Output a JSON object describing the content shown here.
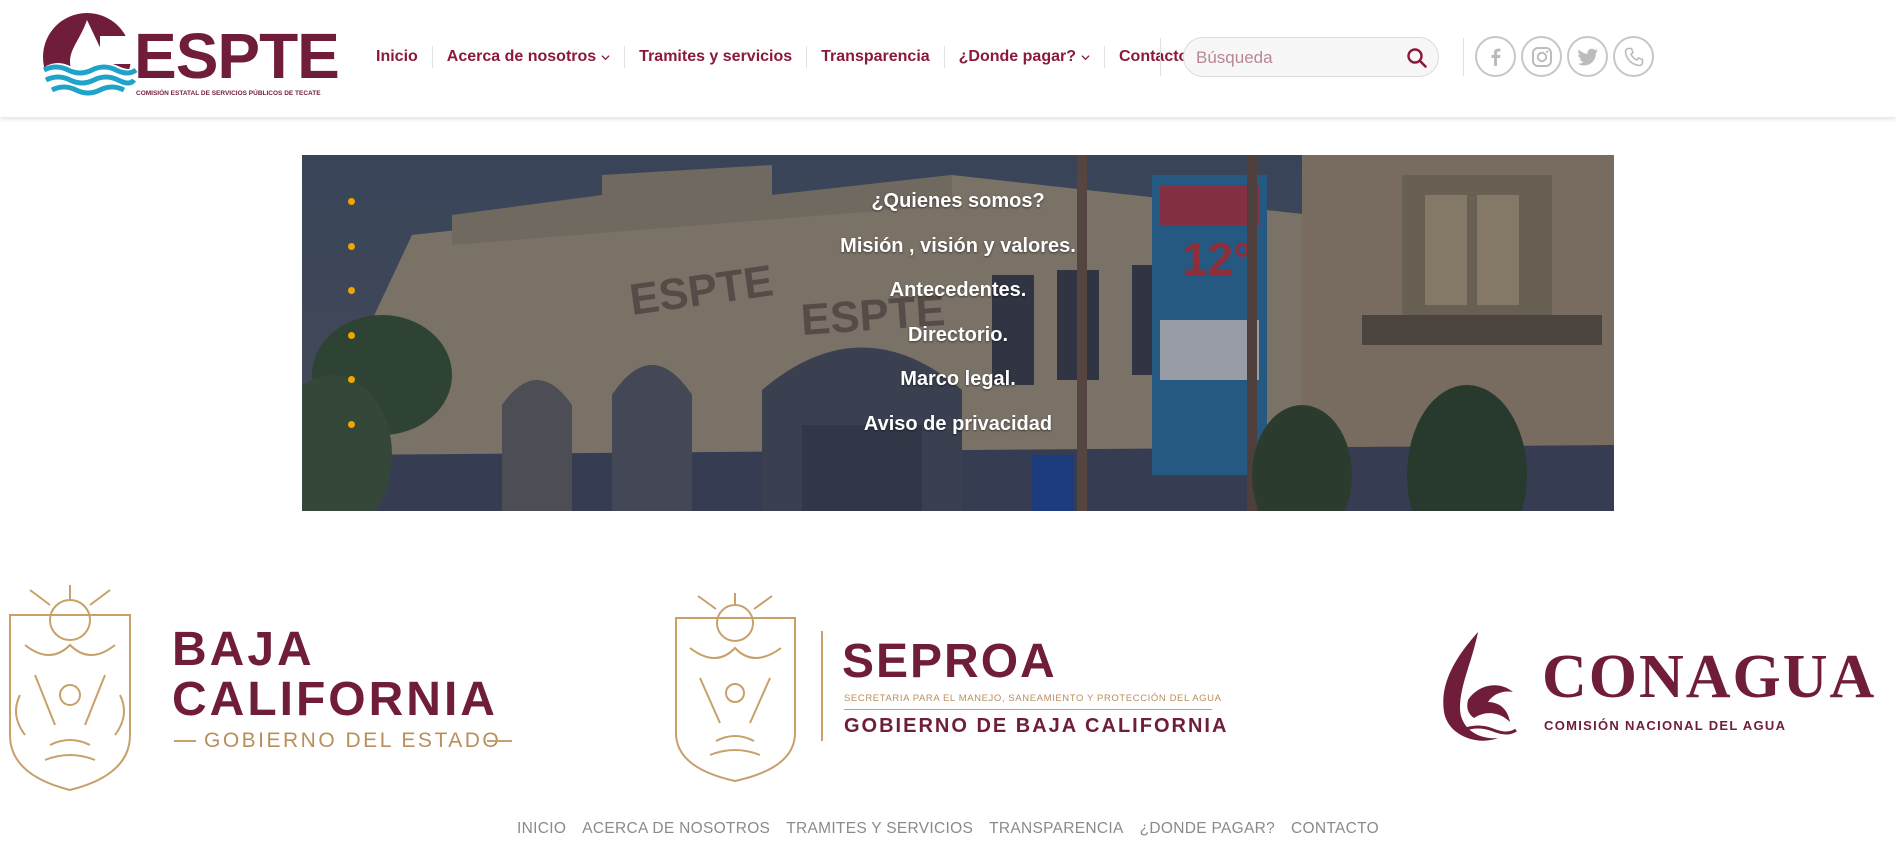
{
  "header": {
    "logo": {
      "text": "ESPTE",
      "subtitle": "COMISIÓN ESTATAL DE SERVICIOS PÚBLICOS DE TECATE"
    },
    "nav": [
      {
        "label": "Inicio",
        "has_dropdown": false
      },
      {
        "label": "Acerca de nosotros",
        "has_dropdown": true
      },
      {
        "label": "Tramites y servicios",
        "has_dropdown": false
      },
      {
        "label": "Transparencia",
        "has_dropdown": false
      },
      {
        "label": "¿Donde pagar?",
        "has_dropdown": true
      },
      {
        "label": "Contacto",
        "has_dropdown": false
      }
    ],
    "search": {
      "placeholder": "Búsqueda",
      "value": ""
    },
    "socials": [
      "facebook-icon",
      "instagram-icon",
      "twitter-icon",
      "phone-icon"
    ]
  },
  "hero": {
    "items": [
      "¿Quienes somos?",
      "Misión , visión y valores.",
      "Antecedentes.",
      "Directorio.",
      "Marco legal.",
      "Aviso de privacidad"
    ],
    "building_signs": {
      "espte": "ESPTE",
      "banner_number": "12°"
    }
  },
  "partners": {
    "baja_california": {
      "line1": "BAJA",
      "line2": "CALIFORNIA",
      "tagline": "GOBIERNO DEL ESTADO"
    },
    "seproa": {
      "title": "SEPROA",
      "subtitle": "SECRETARIA PARA EL MANEJO, SANEAMIENTO Y PROTECCIÓN DEL AGUA",
      "tagline": "GOBIERNO DE BAJA CALIFORNIA"
    },
    "conagua": {
      "title": "CONAGUA",
      "subtitle": "COMISIÓN NACIONAL DEL AGUA"
    }
  },
  "footer_nav": [
    "INICIO",
    "ACERCA DE NOSOTROS",
    "TRAMITES Y SERVICIOS",
    "TRANSPARENCIA",
    "¿DONDE PAGAR?",
    "CONTACTO"
  ],
  "colors": {
    "brand": "#6f1d3b",
    "nav_text": "#8b1a3a",
    "bullet": "#f0a500",
    "gold": "#b88f5c",
    "wave_blue": "#1fa3c9"
  }
}
